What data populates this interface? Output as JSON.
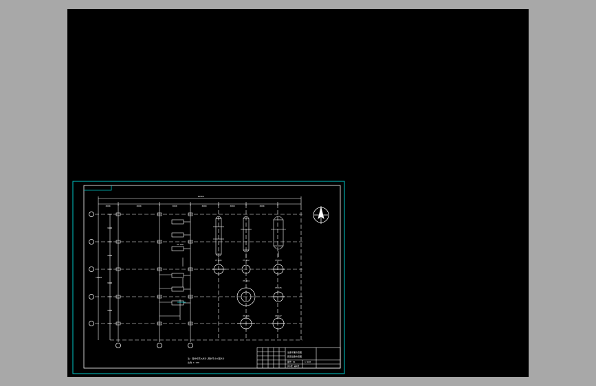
{
  "colors": {
    "background": "#a8a8a8",
    "canvas": "#000000",
    "frame": "#00c8c8",
    "linework": "#ffffff",
    "text": "#ffffff",
    "circle": "#ffffff"
  },
  "drawing": {
    "north_symbol": "north-arrow-icon",
    "overall_dim": "16500",
    "grid_dims": [
      "3000",
      "3000",
      "3000",
      "3000",
      "3000",
      "3000"
    ],
    "row_dims": [
      "3000",
      "3000",
      "3000",
      "3000"
    ],
    "total_row_dim": "12000",
    "equipment_labels": [
      "PT-101",
      "PT-102",
      "PT-103",
      "PT-104",
      "PT-105",
      "PT-106",
      "PT-107",
      "PT-108"
    ],
    "note_line1": "注: 图中标高以米计,其余尺寸以毫米计",
    "note_line2": "比例 1:100"
  },
  "title_block": {
    "title_line1": "设备平面布置图",
    "title_line2": "装置设备布置图",
    "drawing_no": "图号 01",
    "scale": "1:100",
    "sheet": "共1张 第1张"
  }
}
